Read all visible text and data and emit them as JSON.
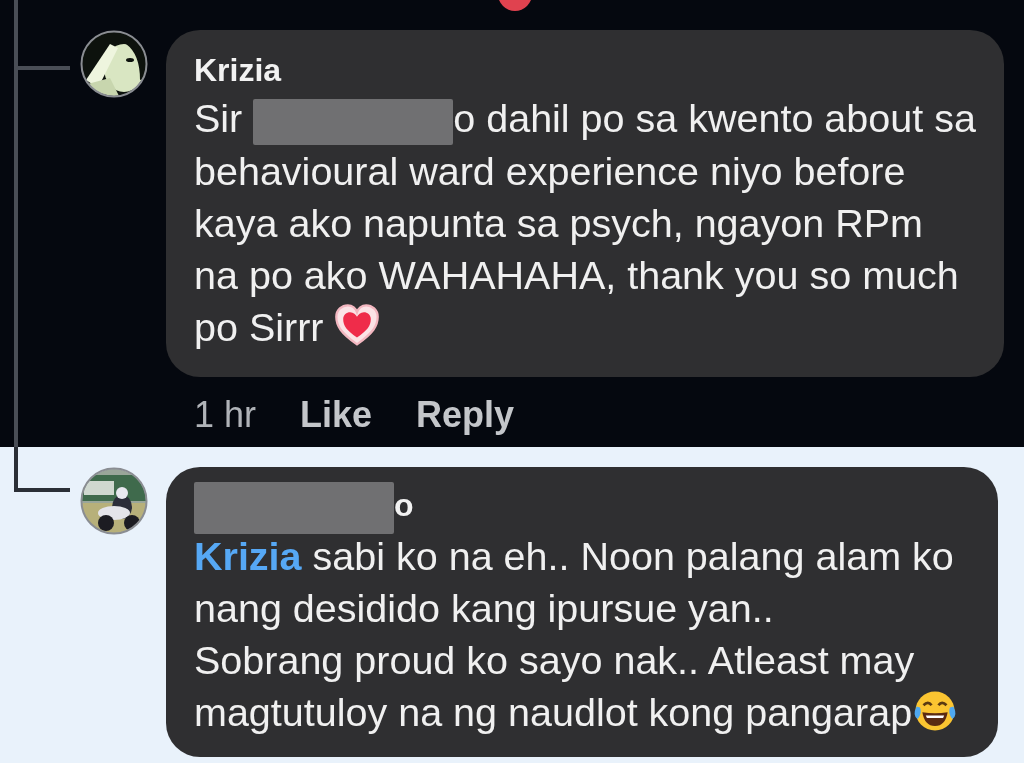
{
  "comments": [
    {
      "dark_background": true,
      "author": [
        {
          "kind": "text",
          "text": "Krizia"
        }
      ],
      "body": [
        {
          "kind": "text",
          "text": "Sir "
        },
        {
          "kind": "redaction"
        },
        {
          "kind": "text",
          "text": "o dahil po sa kwento about sa behavioural ward experience niyo before kaya ako napunta sa psych, ngayon RPm na po ako WAHAHAHA, thank you so much po Sirrr "
        },
        {
          "kind": "heart"
        }
      ],
      "meta": {
        "time": "1 hr",
        "actions": [
          "Like",
          "Reply"
        ]
      }
    },
    {
      "dark_background": false,
      "author": [
        {
          "kind": "redaction"
        },
        {
          "kind": "text",
          "text": "o"
        }
      ],
      "body": [
        {
          "kind": "mention",
          "text": "Krizia"
        },
        {
          "kind": "text",
          "text": " sabi ko na eh.. Noon palang alam ko nang desidido kang ipursue yan.."
        },
        {
          "kind": "break"
        },
        {
          "kind": "text",
          "text": "Sobrang proud ko sayo nak.. Atleast may magtutuloy na ng naudlot kong pangarap"
        },
        {
          "kind": "laugh-cry"
        }
      ]
    }
  ]
}
